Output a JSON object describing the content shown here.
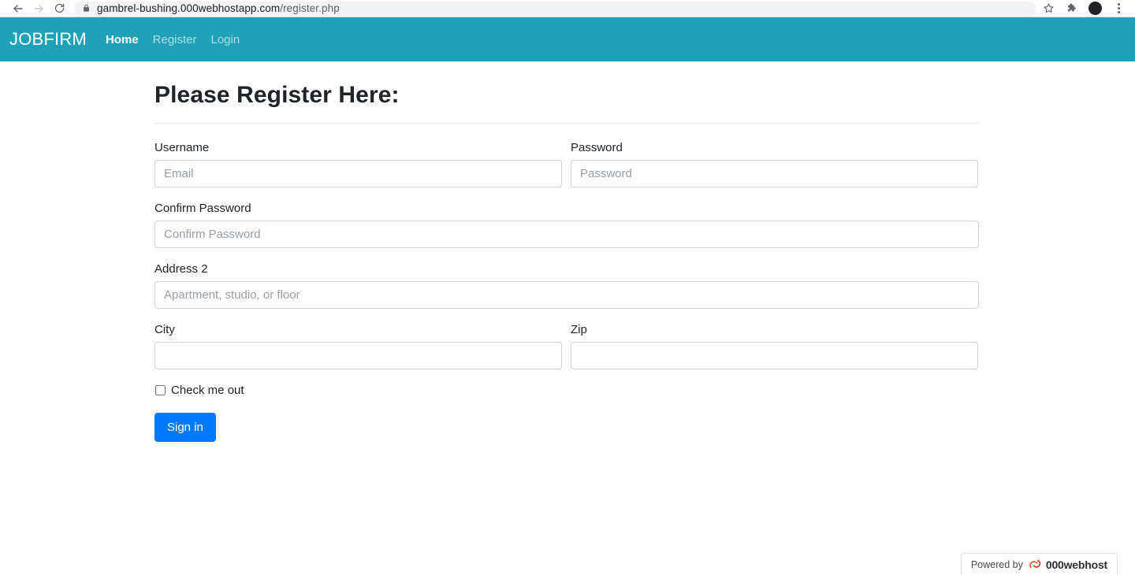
{
  "browser": {
    "back_icon": "back-arrow-icon",
    "forward_icon": "forward-arrow-icon",
    "reload_icon": "reload-icon",
    "lock_icon": "lock-icon",
    "url_domain": "gambrel-bushing.000webhostapp.com",
    "url_path": "/register.php",
    "bookmark_icon": "star-icon",
    "extensions_icon": "puzzle-piece-icon",
    "profile_icon": "profile-avatar-icon",
    "menu_icon": "three-dot-menu-icon"
  },
  "navbar": {
    "brand": "JOBFIRM",
    "background_color": "#1fa2b8",
    "links": [
      {
        "label": "Home",
        "active": true
      },
      {
        "label": "Register",
        "active": false
      },
      {
        "label": "Login",
        "active": false
      }
    ]
  },
  "page": {
    "title": "Please Register Here:"
  },
  "form": {
    "fields": {
      "username": {
        "label": "Username",
        "placeholder": "Email",
        "value": ""
      },
      "password": {
        "label": "Password",
        "placeholder": "Password",
        "value": ""
      },
      "confirm_password": {
        "label": "Confirm Password",
        "placeholder": "Confirm Password",
        "value": ""
      },
      "address2": {
        "label": "Address 2",
        "placeholder": "Apartment, studio, or floor",
        "value": ""
      },
      "city": {
        "label": "City",
        "placeholder": "",
        "value": ""
      },
      "zip": {
        "label": "Zip",
        "placeholder": "",
        "value": ""
      }
    },
    "checkbox": {
      "label": "Check me out",
      "checked": false
    },
    "submit": {
      "label": "Sign in",
      "color": "#007bff"
    }
  },
  "footer_badge": {
    "powered_by": "Powered by",
    "brand": "000webhost",
    "logo_icon": "000webhost-swoosh-icon",
    "logo_color": "#e8552d"
  }
}
